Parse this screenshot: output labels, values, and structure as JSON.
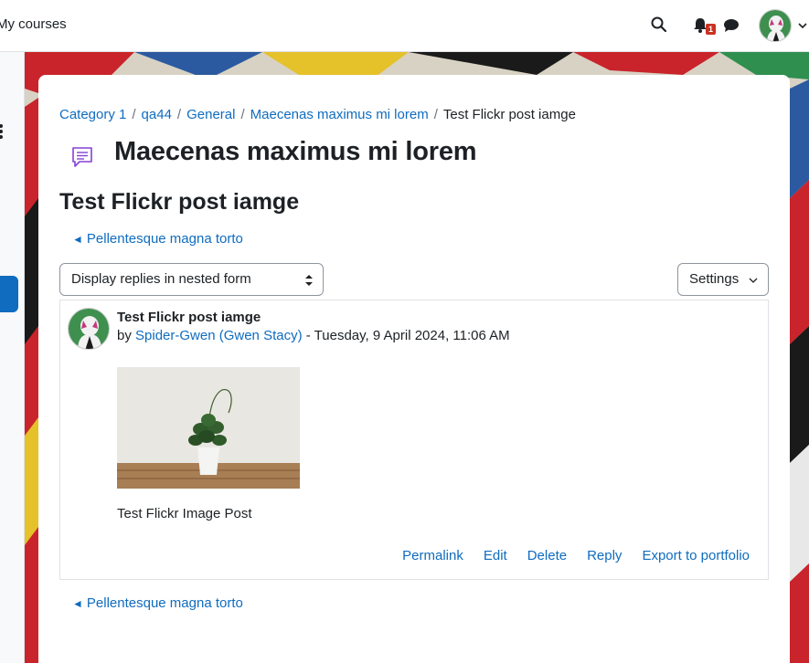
{
  "navbar": {
    "my_courses": "My courses",
    "notification_count": "1",
    "icons": [
      "search-icon",
      "bell-icon",
      "chat-icon",
      "chevron-down-icon"
    ]
  },
  "breadcrumb": [
    {
      "label": "Category 1",
      "link": true
    },
    {
      "label": "qa44",
      "link": true
    },
    {
      "label": "General",
      "link": true
    },
    {
      "label": "Maecenas maximus mi lorem",
      "link": true
    },
    {
      "label": "Test Flickr post iamge",
      "link": false
    }
  ],
  "forum_title": "Maecenas maximus mi lorem",
  "discussion_title": "Test Flickr post iamge",
  "nav": {
    "prev_arrow": "◄",
    "prev_label": "Pellentesque magna torto"
  },
  "display_mode": {
    "selected": "Display replies in nested form"
  },
  "settings_label": "Settings",
  "post": {
    "subject": "Test Flickr post iamge",
    "by": "by",
    "author": "Spider-Gwen (Gwen Stacy)",
    "date": "- Tuesday, 9 April 2024, 11:06 AM",
    "body": "Test Flickr Image Post",
    "actions": [
      "Permalink",
      "Edit",
      "Delete",
      "Reply",
      "Export to portfolio"
    ]
  },
  "colors": {
    "link": "#0f6cbf",
    "badge": "#ca3120",
    "forum_icon": "#8540d6"
  }
}
